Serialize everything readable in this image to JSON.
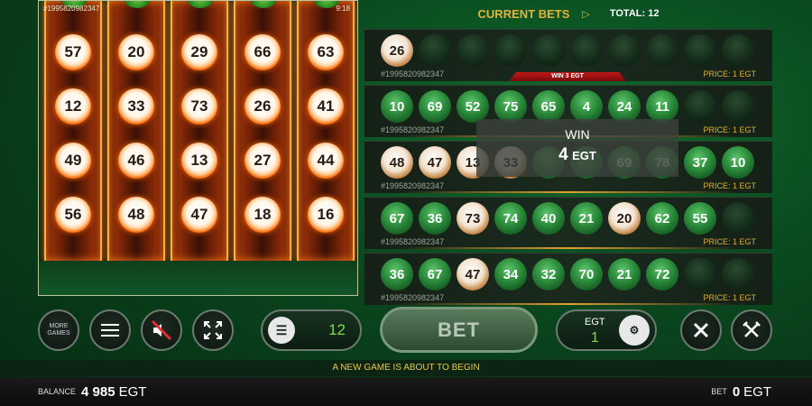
{
  "reels": {
    "ticket_id": "#1995820982347",
    "clock": "9:18",
    "columns": [
      [
        "57",
        "12",
        "49",
        "56"
      ],
      [
        "20",
        "33",
        "46",
        "48"
      ],
      [
        "29",
        "73",
        "13",
        "47"
      ],
      [
        "66",
        "26",
        "27",
        "18"
      ],
      [
        "63",
        "41",
        "44",
        "16"
      ]
    ]
  },
  "bets": {
    "title": "CURRENT BETS",
    "total_label": "TOTAL:",
    "total_value": "12",
    "tickets": [
      {
        "id": "#1995820982347",
        "price": "PRICE: 1 EGT",
        "banner": "WIN 3 EGT",
        "balls": [
          {
            "n": "26",
            "c": "gold"
          },
          {
            "n": "",
            "c": "empty"
          },
          {
            "n": "",
            "c": "empty"
          },
          {
            "n": "",
            "c": "empty"
          },
          {
            "n": "",
            "c": "empty"
          },
          {
            "n": "",
            "c": "empty"
          },
          {
            "n": "",
            "c": "empty"
          },
          {
            "n": "",
            "c": "empty"
          },
          {
            "n": "",
            "c": "empty"
          },
          {
            "n": "",
            "c": "empty"
          }
        ]
      },
      {
        "id": "#1995820982347",
        "price": "PRICE: 1 EGT",
        "balls": [
          {
            "n": "10",
            "c": "green"
          },
          {
            "n": "69",
            "c": "green"
          },
          {
            "n": "52",
            "c": "green"
          },
          {
            "n": "75",
            "c": "green"
          },
          {
            "n": "65",
            "c": "green"
          },
          {
            "n": "4",
            "c": "green"
          },
          {
            "n": "24",
            "c": "green"
          },
          {
            "n": "11",
            "c": "green"
          },
          {
            "n": "",
            "c": "empty"
          },
          {
            "n": "",
            "c": "empty"
          }
        ]
      },
      {
        "id": "#1995820982347",
        "price": "PRICE: 1 EGT",
        "balls": [
          {
            "n": "48",
            "c": "gold"
          },
          {
            "n": "47",
            "c": "gold"
          },
          {
            "n": "13",
            "c": "gold"
          },
          {
            "n": "33",
            "c": "gold"
          },
          {
            "n": "",
            "c": "green"
          },
          {
            "n": "",
            "c": "green"
          },
          {
            "n": "69",
            "c": "green"
          },
          {
            "n": "78",
            "c": "green"
          },
          {
            "n": "37",
            "c": "green"
          },
          {
            "n": "10",
            "c": "green"
          }
        ]
      },
      {
        "id": "#1995820982347",
        "price": "PRICE: 1 EGT",
        "balls": [
          {
            "n": "67",
            "c": "green"
          },
          {
            "n": "36",
            "c": "green"
          },
          {
            "n": "73",
            "c": "gold"
          },
          {
            "n": "74",
            "c": "green"
          },
          {
            "n": "40",
            "c": "green"
          },
          {
            "n": "21",
            "c": "green"
          },
          {
            "n": "20",
            "c": "gold"
          },
          {
            "n": "62",
            "c": "green"
          },
          {
            "n": "55",
            "c": "green"
          },
          {
            "n": "",
            "c": "empty"
          }
        ]
      },
      {
        "id": "#1995820982347",
        "price": "PRICE: 1 EGT",
        "balls": [
          {
            "n": "36",
            "c": "green"
          },
          {
            "n": "67",
            "c": "green"
          },
          {
            "n": "47",
            "c": "gold"
          },
          {
            "n": "34",
            "c": "green"
          },
          {
            "n": "32",
            "c": "green"
          },
          {
            "n": "70",
            "c": "green"
          },
          {
            "n": "21",
            "c": "green"
          },
          {
            "n": "72",
            "c": "green"
          },
          {
            "n": "",
            "c": "empty"
          },
          {
            "n": "",
            "c": "empty"
          }
        ]
      }
    ]
  },
  "win": {
    "label": "WIN",
    "amount": "4",
    "currency": "EGT"
  },
  "controls": {
    "more_games": "MORE GAMES",
    "tickets_count": "12",
    "bet_label": "BET",
    "egt_label": "EGT",
    "egt_value": "1"
  },
  "message": "A NEW GAME IS ABOUT TO BEGIN",
  "footer": {
    "balance_label": "BALANCE",
    "balance_value": "4 985",
    "balance_currency": "EGT",
    "bet_label": "BET",
    "bet_value": "0",
    "bet_currency": "EGT"
  },
  "colors": {
    "gold": "#e0b43a",
    "green": "#7fd94a",
    "win_red": "#c01818"
  }
}
